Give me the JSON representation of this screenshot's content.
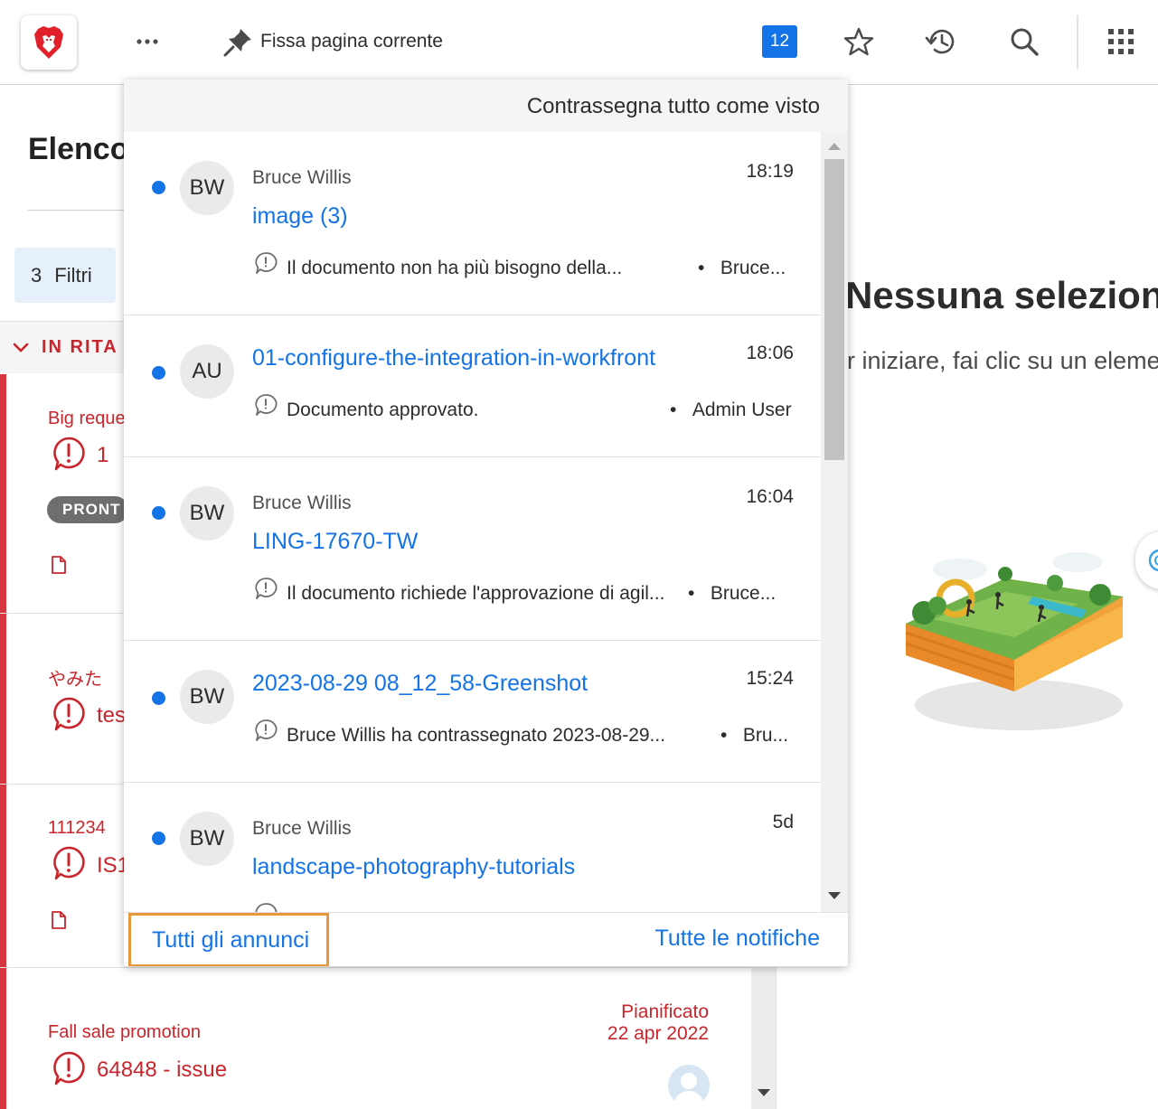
{
  "topbar": {
    "more_label": "•••",
    "pin_label": "Fissa pagina corrente",
    "notif_count": "12"
  },
  "left_panel": {
    "title": "Elenco",
    "filters_count": "3",
    "filters_label": "Filtri",
    "section_label": "IN RITA",
    "cards": [
      {
        "name": "Big reque",
        "count": "1",
        "status": "PRONT"
      },
      {
        "name": "やみた",
        "id": "tes"
      },
      {
        "name": "111234",
        "id": "IS1"
      },
      {
        "name": "Fall sale promotion",
        "id": "64848 - issue",
        "schedule_label": "Pianificato",
        "schedule_date": "22 apr 2022"
      }
    ]
  },
  "right_panel": {
    "empty_title": "Nessuna selezion",
    "empty_subtitle": "r iniziare, fai clic su un eleme"
  },
  "notifications": {
    "mark_all_label": "Contrassegna tutto come visto",
    "items": [
      {
        "initials": "BW",
        "sender": "Bruce Willis",
        "title": "image (3)",
        "time": "18:19",
        "message": "Il documento non ha più bisogno della...",
        "by": "Bruce..."
      },
      {
        "initials": "AU",
        "sender": "",
        "title": "01-configure-the-integration-in-workfront",
        "time": "18:06",
        "message": "Documento approvato.",
        "by": "Admin User"
      },
      {
        "initials": "BW",
        "sender": "Bruce Willis",
        "title": "LING-17670-TW",
        "time": "16:04",
        "message": "Il documento richiede l'approvazione di agil...",
        "by": "Bruce..."
      },
      {
        "initials": "BW",
        "sender": "",
        "title": "2023-08-29 08_12_58-Greenshot",
        "time": "15:24",
        "message": "Bruce Willis ha contrassegnato 2023-08-29...",
        "by": "Bru..."
      },
      {
        "initials": "BW",
        "sender": "Bruce Willis",
        "title": "landscape-photography-tutorials",
        "time": "5d",
        "message": "",
        "by": ""
      }
    ],
    "all_announcements_label": "Tutti gli annunci",
    "all_notifications_label": "Tutte le notifiche"
  },
  "colors": {
    "accent_blue": "#1473e6",
    "alert_red": "#c9252c",
    "highlight_orange": "#e8963c"
  }
}
